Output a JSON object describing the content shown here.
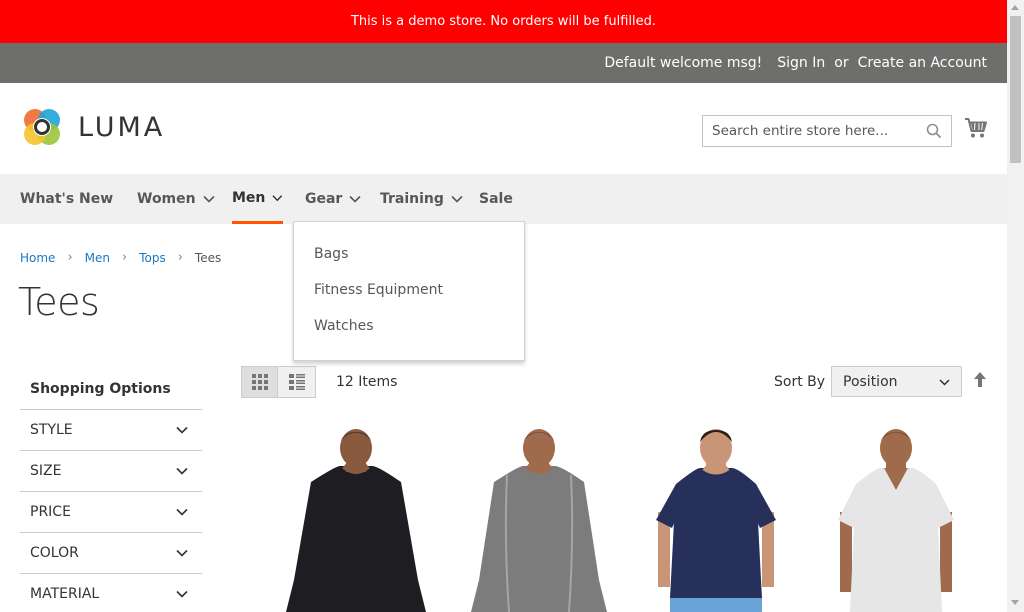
{
  "demo_notice": "This is a demo store. No orders will be fulfilled.",
  "panel": {
    "welcome": "Default welcome msg!",
    "sign_in": "Sign In",
    "or": "or",
    "create_account": "Create an Account"
  },
  "logo": {
    "text": "LUMA"
  },
  "search": {
    "placeholder": "Search entire store here..."
  },
  "nav": {
    "items": [
      {
        "label": "What's New",
        "has_dropdown": false
      },
      {
        "label": "Women",
        "has_dropdown": true
      },
      {
        "label": "Men",
        "has_dropdown": true,
        "active": true
      },
      {
        "label": "Gear",
        "has_dropdown": true
      },
      {
        "label": "Training",
        "has_dropdown": true
      },
      {
        "label": "Sale",
        "has_dropdown": false
      }
    ],
    "gear_dropdown": [
      "Bags",
      "Fitness Equipment",
      "Watches"
    ]
  },
  "breadcrumbs": [
    "Home",
    "Men",
    "Tops",
    "Tees"
  ],
  "page_title": "Tees",
  "sidebar": {
    "title": "Shopping Options",
    "filters": [
      "STYLE",
      "SIZE",
      "PRICE",
      "COLOR",
      "MATERIAL"
    ]
  },
  "toolbar": {
    "items_count": "12 Items",
    "sort_label": "Sort By",
    "sort_value": "Position"
  },
  "products": [
    {
      "shirt_color": "#1e1e22",
      "sleeve": "long"
    },
    {
      "shirt_color": "#7c7c7c",
      "sleeve": "long"
    },
    {
      "shirt_color": "#27305a",
      "sleeve": "short"
    },
    {
      "shirt_color": "#e6e6e6",
      "sleeve": "short"
    }
  ],
  "colors": {
    "demo_bar": "#ff0000",
    "panel_bg": "#6e6e6d",
    "nav_bg": "#f0f0f0",
    "accent": "#ff5501",
    "link": "#1979c3"
  }
}
